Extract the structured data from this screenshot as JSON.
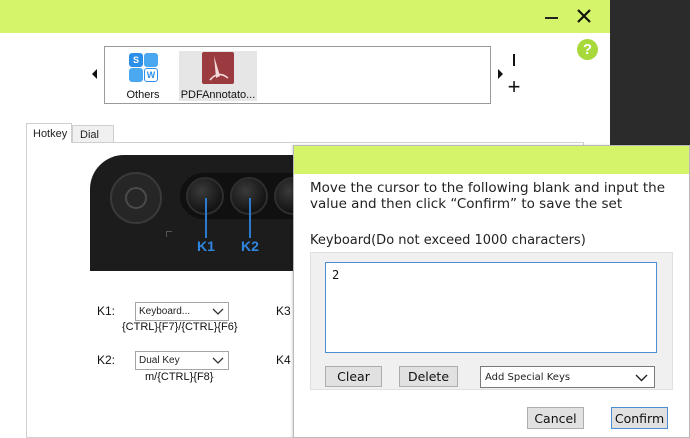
{
  "colors": {
    "accent": "#d6f46a",
    "key_label": "#2f86e0",
    "help": "#a7d93a"
  },
  "window": {
    "minimize_icon": "minimize-icon",
    "close_icon": "close-icon",
    "help_label": "?"
  },
  "apps": {
    "items": [
      {
        "label": "Others",
        "icon": "others-app-icon"
      },
      {
        "label": "PDFAnnotato...",
        "icon": "pdf-annotator-icon",
        "selected": true
      }
    ],
    "remove_label": "|",
    "add_label": "+"
  },
  "tabs": [
    {
      "label": "Hotkey",
      "active": true
    },
    {
      "label": "Dial"
    }
  ],
  "device": {
    "key_labels": [
      "K1",
      "K2",
      "K3"
    ]
  },
  "keys": [
    {
      "name": "K1:",
      "mode": "Keyboard...",
      "value": "{CTRL}{F7}/{CTRL}{F6}"
    },
    {
      "name": "K2:",
      "mode": "Dual Key",
      "value": "m/{CTRL}{F8}"
    },
    {
      "name": "K3"
    },
    {
      "name": "K4"
    }
  ],
  "dialog": {
    "instruction": "Move the cursor to the following blank and input the value and then click “Confirm” to save the set",
    "field_label": "Keyboard(Do not exceed 1000 characters)",
    "value": "2",
    "clear_label": "Clear",
    "delete_label": "Delete",
    "special_keys_label": "Add Special Keys",
    "cancel_label": "Cancel",
    "confirm_label": "Confirm"
  }
}
